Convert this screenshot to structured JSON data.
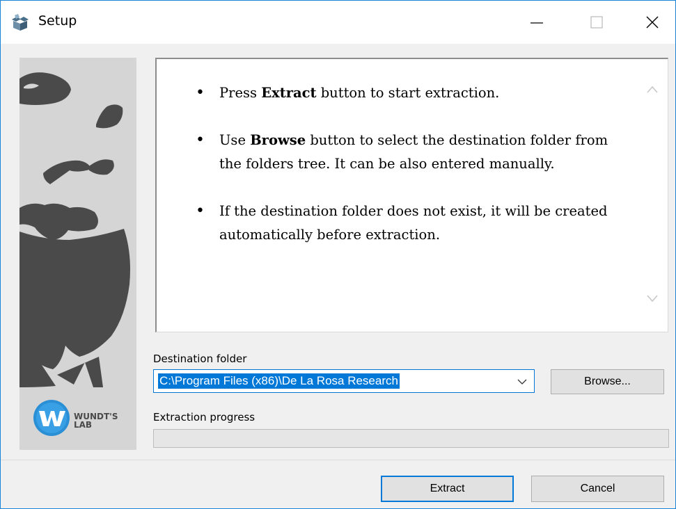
{
  "window": {
    "title": "Setup",
    "controls": {
      "minimize_icon": "minimize-icon",
      "maximize_icon": "maximize-icon",
      "close_icon": "close-icon"
    }
  },
  "banner": {
    "logo_line1": "WUNDT'S",
    "logo_line2": "LAB",
    "logo_letter": "W"
  },
  "instructions": {
    "item1": {
      "before": "Press ",
      "bold": "Extract",
      "after": " button to start extraction."
    },
    "item2": {
      "before": "Use ",
      "bold": "Browse",
      "after": " button to select the destination folder from the folders tree. It can be also entered manually."
    },
    "item3": {
      "text": "If the destination folder does not exist, it will be created automatically before extraction."
    }
  },
  "destination": {
    "label": "Destination folder",
    "value": "C:\\Program Files (x86)\\De La Rosa Research",
    "browse_label": "Browse..."
  },
  "progress": {
    "label": "Extraction progress",
    "value": 0
  },
  "buttons": {
    "extract_label": "Extract",
    "cancel_label": "Cancel"
  },
  "colors": {
    "accent": "#0078d7",
    "window_border": "#1883d7",
    "banner_bg": "#d5d5d5",
    "portrait": "#4a4a4a",
    "logo_blue": "#2b8fd6"
  }
}
